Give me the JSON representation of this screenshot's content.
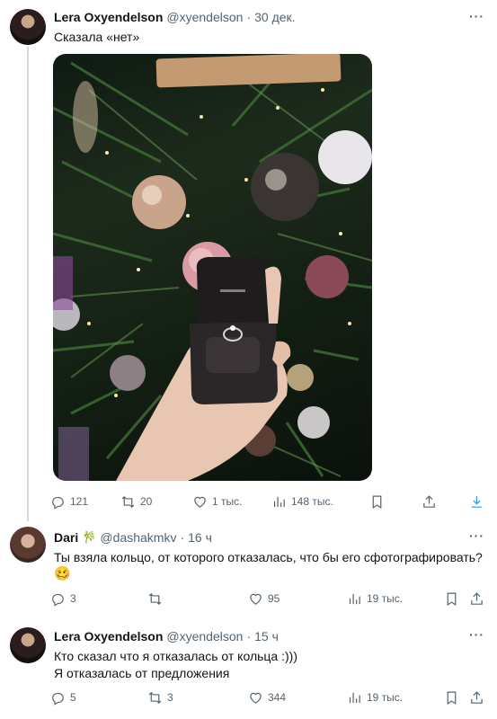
{
  "tweets": [
    {
      "name": "Lera Oxyendelson",
      "handle": "@xyendelson",
      "dot": "·",
      "time": "30 дек.",
      "text": "Сказала «нет»",
      "replies": "121",
      "retweets": "20",
      "likes": "1 тыс.",
      "views": "148 тыс."
    },
    {
      "name": "Dari",
      "badge": "🎋",
      "handle": "@dashakmkv",
      "dot": "·",
      "time": "16 ч",
      "text": "Ты взяла кольцо, от которого отказалась, что бы его сфотографировать?",
      "emoji": "🥴",
      "replies": "3",
      "retweets": "",
      "likes": "95",
      "views": "19 тыс."
    },
    {
      "name": "Lera Oxyendelson",
      "handle": "@xyendelson",
      "dot": "·",
      "time": "15 ч",
      "line1": "Кто сказал что я отказалась от кольца :)))",
      "line2": "Я отказалась от предложения",
      "replies": "5",
      "retweets": "3",
      "likes": "344",
      "views": "19 тыс."
    }
  ],
  "more_label": "···",
  "icons": [
    "reply-icon",
    "retweet-icon",
    "like-icon",
    "views-icon",
    "bookmark-icon",
    "share-icon",
    "download-icon"
  ],
  "colors": {
    "text": "#0f1419",
    "secondary": "#536471",
    "accent": "#1d9bf0",
    "thread": "#cfd9de"
  }
}
